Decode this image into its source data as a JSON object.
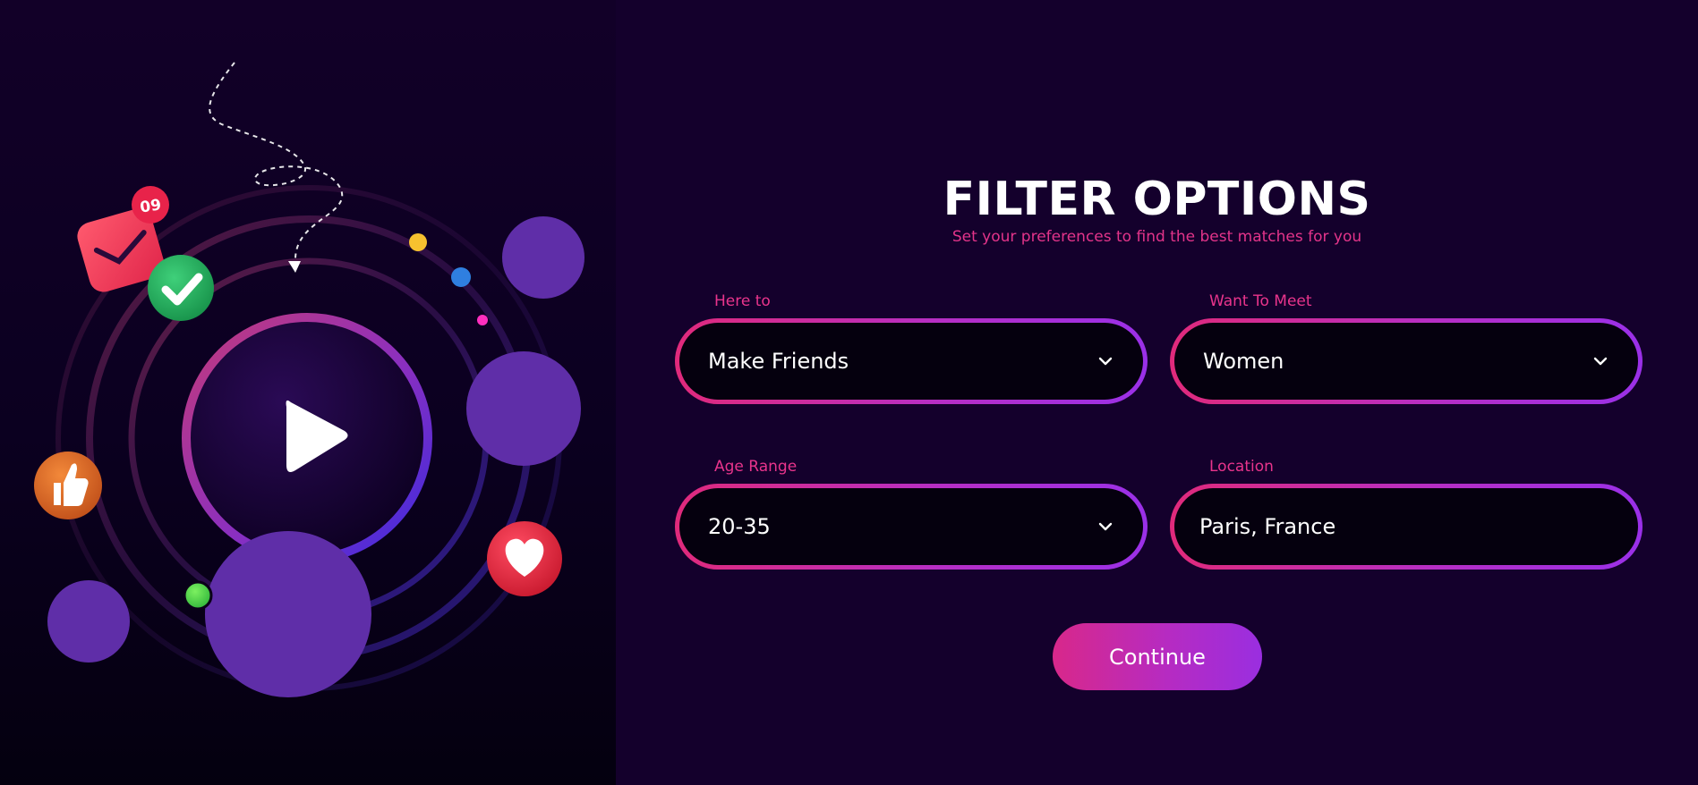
{
  "header": {
    "title": "FILTER OPTIONS",
    "subtitle": "Set your preferences to find the best matches for you"
  },
  "filters": {
    "here_to": {
      "label": "Here to",
      "value": "Make Friends"
    },
    "want_to_meet": {
      "label": "Want To Meet",
      "value": "Women"
    },
    "age_range": {
      "label": "Age Range",
      "value": "20-35"
    },
    "location": {
      "label": "Location",
      "value": "Paris, France"
    }
  },
  "actions": {
    "continue_label": "Continue"
  },
  "illustration": {
    "notification_badge": "09",
    "icons": [
      "envelope-icon",
      "check-icon",
      "play-icon",
      "thumbs-up-icon",
      "heart-icon",
      "chevron-down-icon"
    ]
  },
  "colors": {
    "background": "#14002c",
    "accent_pink": "#e3348a",
    "accent_purple": "#9a30e8",
    "bubble_purple": "#5f2ea8",
    "field_fill": "#05000e"
  }
}
